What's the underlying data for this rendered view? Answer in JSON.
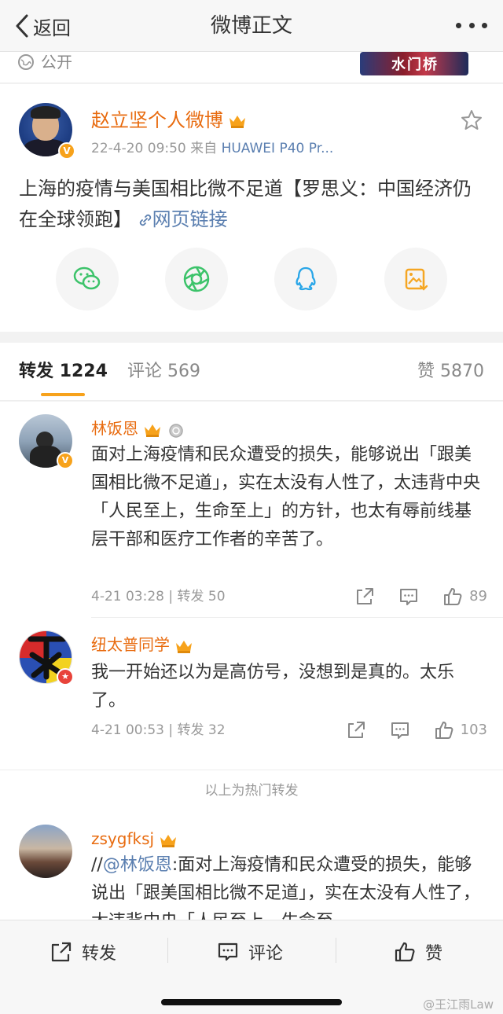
{
  "nav": {
    "back_label": "返回",
    "title": "微博正文"
  },
  "top": {
    "visibility": "公开",
    "thumb_text": "水门桥"
  },
  "post": {
    "author": "赵立坚个人微博",
    "time": "22-4-20 09:50",
    "source_prefix": "来自",
    "source": "HUAWEI P40 Pr...",
    "text": "上海的疫情与美国相比微不足道【罗思义：中国经济仍在全球领跑】",
    "link_text": "网页链接",
    "share_targets": [
      "wechat-icon",
      "moments-icon",
      "qq-icon",
      "save-image-icon"
    ]
  },
  "tabs": {
    "repost_label": "转发",
    "repost_count": "1224",
    "comment_label": "评论",
    "comment_count": "569",
    "like_label": "赞",
    "like_count": "5870"
  },
  "reposts": [
    {
      "user": "林饭恩",
      "text": "面对上海疫情和民众遭受的损失，能够说出「跟美国相比微不足道」，实在太没有人性了，太违背中央「人民至上，生命至上」的方针，也太有辱前线基层干部和医疗工作者的辛苦了。",
      "meta": "4-21 03:28 | 转发 50",
      "likes": "89"
    },
    {
      "user": "纽太普同学",
      "text": "我一开始还以为是高仿号，没想到是真的。太乐了。",
      "meta": "4-21 00:53 | 转发 32",
      "likes": "103"
    },
    {
      "user": "zsygfksj",
      "prefix": "//",
      "mention": "@林饭恩",
      "text": ":面对上海疫情和民众遭受的损失，能够说出「跟美国相比微不足道」，实在太没有人性了，太违背中央「人民至上，生命至"
    }
  ],
  "hot_label": "以上为热门转发",
  "bottom": {
    "repost": "转发",
    "comment": "评论",
    "like": "赞"
  },
  "watermark": "@王江雨Law",
  "colors": {
    "brand_orange": "#e86b0f",
    "link_blue": "#5b7fb0",
    "accent": "#f7a21b"
  }
}
